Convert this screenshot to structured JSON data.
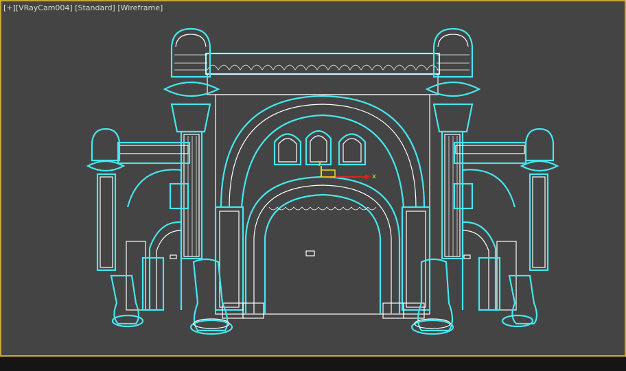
{
  "viewport": {
    "label_open": "[",
    "label_plus": "+",
    "label_close": "]",
    "camera": "VRayCam004",
    "shading": "Standard",
    "display_mode": "Wireframe",
    "camera_display": "[VRayCam004]",
    "shading_display": "[Standard]",
    "mode_display": "[Wireframe]",
    "active_border_color": "#c8a82a",
    "background_color": "#444444",
    "wire_color": "#ffffff",
    "selection_glow_color": "#46e6ee"
  },
  "gizmo": {
    "x_axis_label": "x",
    "y_axis_label": "y"
  }
}
